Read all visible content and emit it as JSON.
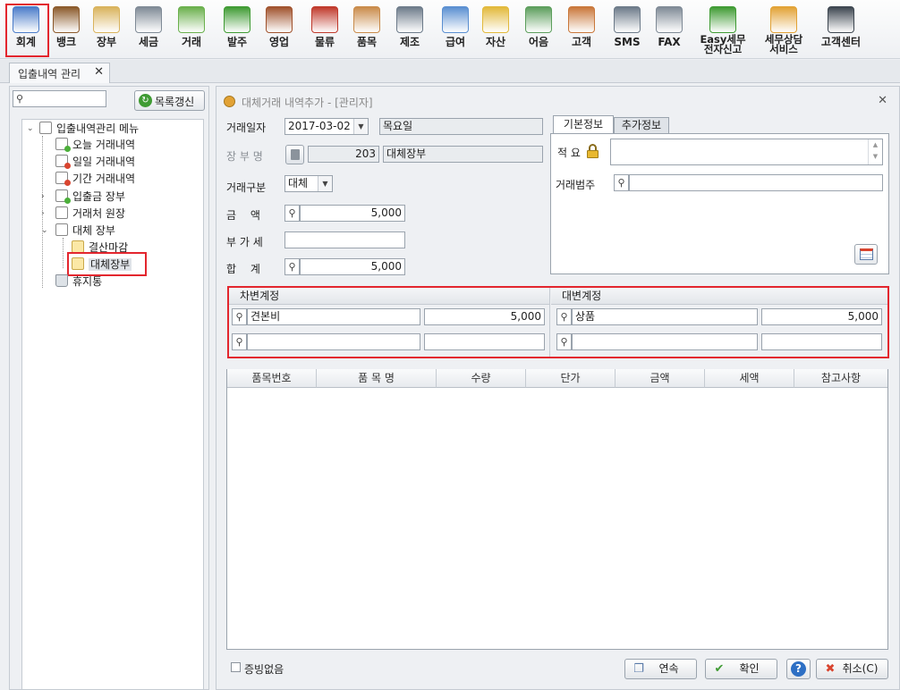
{
  "toolbar": {
    "items": [
      {
        "label": "회계",
        "icon": "ledger-calculator-icon"
      },
      {
        "label": "뱅크",
        "icon": "bank-icon"
      },
      {
        "label": "장부",
        "icon": "clipboard-icon"
      },
      {
        "label": "세금",
        "icon": "tax-calculator-icon"
      },
      {
        "label": "거래",
        "icon": "cash-icon"
      },
      {
        "label": "발주",
        "icon": "order-document-icon"
      },
      {
        "label": "영업",
        "icon": "briefcase-icon"
      },
      {
        "label": "물류",
        "icon": "truck-icon"
      },
      {
        "label": "품목",
        "icon": "boxes-icon"
      },
      {
        "label": "제조",
        "icon": "tools-icon"
      },
      {
        "label": "급여",
        "icon": "payroll-card-icon"
      },
      {
        "label": "자산",
        "icon": "money-bag-icon"
      },
      {
        "label": "어음",
        "icon": "bill-note-icon"
      },
      {
        "label": "고객",
        "icon": "customers-icon"
      },
      {
        "label": "SMS",
        "icon": "sms-phone-icon"
      },
      {
        "label": "FAX",
        "icon": "fax-icon"
      },
      {
        "label": "Easy세무 전자신고",
        "icon": "e-tax-filing-icon"
      },
      {
        "label": "세무상담 서비스",
        "icon": "tax-consult-chat-icon"
      },
      {
        "label": "고객센터",
        "icon": "headset-icon"
      }
    ]
  },
  "doc_tab": {
    "label": "입출내역 관리",
    "close": "✕"
  },
  "left": {
    "refresh_label": "목록갱신",
    "tree": {
      "root": "입출내역관리 메뉴",
      "items": [
        "오늘 거래내역",
        "일일 거래내역",
        "기간 거래내역",
        "입출금 장부",
        "거래처 원장",
        "대체 장부"
      ],
      "sub_items": [
        "결산마감",
        "대체장부"
      ],
      "last": "휴지통"
    }
  },
  "dialog": {
    "title": "대체거래 내역추가 - [관리자]",
    "close": "✕",
    "date_label": "거래일자",
    "date_value": "2017-03-02",
    "weekday": "목요일",
    "ledger_label": "장 부 명",
    "ledger_code": "203",
    "ledger_name": "대체장부",
    "type_label": "거래구분",
    "type_value": "대체",
    "amount_label": "금　 액",
    "amount_value": "5,000",
    "vat_label": "부 가 세",
    "vat_value": "",
    "total_label": "합　 계",
    "total_value": "5,000",
    "tabs": [
      "기본정보",
      "추가정보"
    ],
    "memo_label": "적 요",
    "category_label": "거래범주",
    "debit_title": "차변계정",
    "credit_title": "대변계정",
    "debit_rows": [
      {
        "account": "견본비",
        "amount": "5,000"
      },
      {
        "account": "",
        "amount": ""
      }
    ],
    "credit_rows": [
      {
        "account": "상품",
        "amount": "5,000"
      },
      {
        "account": "",
        "amount": ""
      }
    ],
    "grid_headers": [
      "품목번호",
      "품 목 명",
      "수량",
      "단가",
      "금액",
      "세액",
      "참고사항"
    ],
    "no_proof_label": "증빙없음",
    "btn_continue": "연속",
    "btn_ok": "확인",
    "btn_cancel": "취소(C)"
  },
  "colors": {
    "highlight": "#e3262e",
    "accent": "#2d6fc4"
  }
}
